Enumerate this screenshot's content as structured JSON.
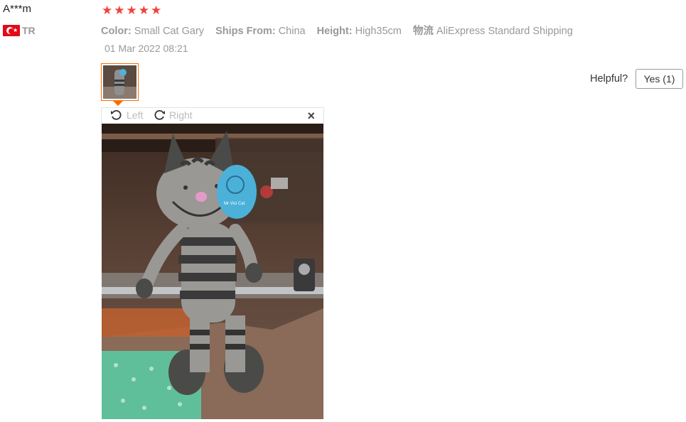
{
  "reviewer": {
    "name": "A***m",
    "country_code": "TR",
    "rating": 5
  },
  "sku": [
    {
      "key": "Color:",
      "value": "Small Cat Gary"
    },
    {
      "key": "Ships From:",
      "value": "China"
    },
    {
      "key": "Height:",
      "value": "High35cm"
    },
    {
      "key": "物流",
      "value": "AliExpress Standard Shipping"
    }
  ],
  "review_date": "01 Mar 2022 08:21",
  "helpful": {
    "label": "Helpful?",
    "yes_button": "Yes (1)"
  },
  "viewer": {
    "rotate_left": "Left",
    "rotate_right": "Right",
    "close": "×",
    "hang_tag_text": "Mr Vici Cat"
  },
  "colors": {
    "star": "#f0423c",
    "thumb_border": "#ff6a00",
    "muted_text": "#999999"
  },
  "icons": [
    "turkey-flag-icon",
    "star-icon",
    "rotate-left-icon",
    "rotate-right-icon",
    "close-icon"
  ]
}
